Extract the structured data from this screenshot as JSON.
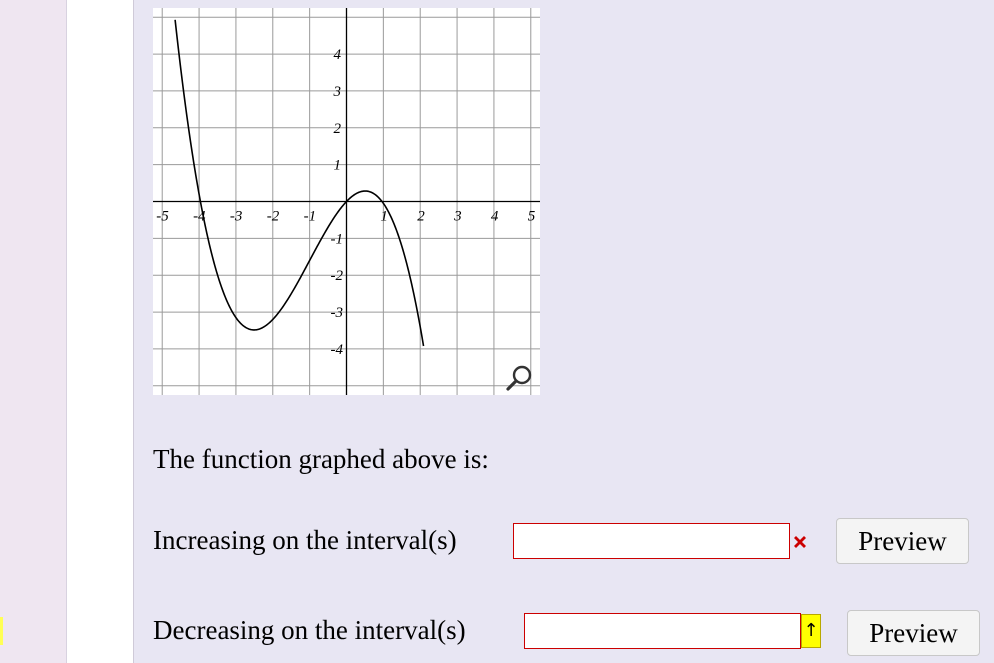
{
  "graph": {
    "x_ticks": [
      "-5",
      "-4",
      "-3",
      "-2",
      "-1",
      "1",
      "2",
      "3",
      "4",
      "5"
    ],
    "y_ticks": [
      "4",
      "3",
      "2",
      "1",
      "-1",
      "-2",
      "-3",
      "-4"
    ],
    "zoom_icon": "magnifier-icon"
  },
  "chart_data": {
    "type": "line",
    "xlim": [
      -5.25,
      5.25
    ],
    "ylim": [
      -5.25,
      5.25
    ],
    "grid": true,
    "series": [
      {
        "x": [
          -4.0,
          -3.5,
          -3.0,
          -2.5,
          -2.0,
          -1.5,
          -1.0,
          -0.5,
          0.0,
          0.5,
          1.0,
          1.5,
          2.0
        ],
        "y": [
          0,
          -2.72,
          -3.85,
          -4.24,
          -3.78,
          -2.82,
          -1.75,
          -0.68,
          0.0,
          0.22,
          -0.1,
          -1.1,
          -2.75
        ]
      }
    ]
  },
  "question": {
    "prompt": "The function graphed above is:",
    "increasing_label": "Increasing on the interval(s)",
    "decreasing_label": "Decreasing on the interval(s)",
    "increasing_value": "",
    "decreasing_value": "",
    "increasing_status_icon": "red-x-icon",
    "decreasing_status_icon": "up-arrow-icon",
    "decreasing_status_glyph": "↑",
    "preview_label": "Preview"
  },
  "colors": {
    "background": "#e8e6f3",
    "input_border": "#cc0000",
    "status_error": "#cc0000",
    "status_warning": "#ffff00"
  }
}
